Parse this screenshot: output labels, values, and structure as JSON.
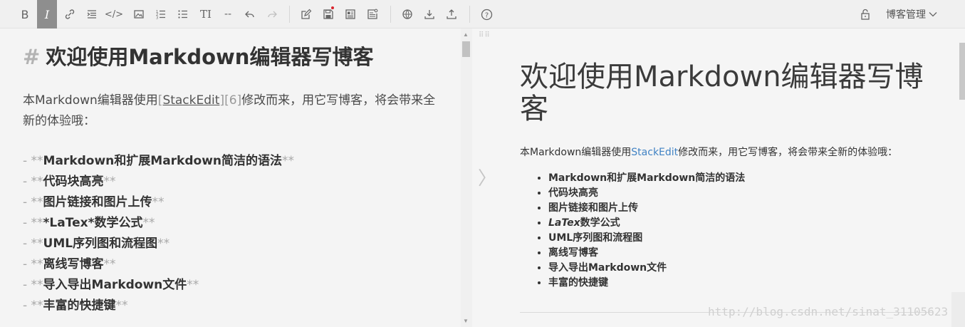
{
  "toolbar": {
    "icons": {
      "bold": "B",
      "italic": "I",
      "link": "link-icon",
      "quote": "quote-icon",
      "code": "</>",
      "image": "image-icon",
      "ordered_list": "ordered-list-icon",
      "unordered_list": "unordered-list-icon",
      "heading": "TI",
      "hr": "--",
      "undo": "undo-icon",
      "redo": "redo-icon",
      "new": "new-doc-icon",
      "save": "save-icon",
      "publish": "publish-icon",
      "settings": "settings-doc-icon",
      "globe": "globe-icon",
      "import": "import-icon",
      "export": "export-icon",
      "help": "?"
    },
    "blog_menu_label": "博客管理"
  },
  "editor": {
    "title_hash": "#",
    "title": "欢迎使用Markdown编辑器写博客",
    "para_before": "本Markdown编辑器使用",
    "para_bracket_open": "[",
    "para_link": "StackEdit",
    "para_bracket_close": "]",
    "para_ref": "[6]",
    "para_after": "修改而来，用它写博客，将会带来全新的体验哦：",
    "list": [
      {
        "prefix": "- **",
        "text": "Markdown和扩展Markdown简洁的语法",
        "suffix": "**"
      },
      {
        "prefix": "- **",
        "text": "代码块高亮",
        "suffix": "**"
      },
      {
        "prefix": "- **",
        "text": "图片链接和图片上传",
        "suffix": "**"
      },
      {
        "prefix": "- **",
        "text": "*LaTex*数学公式",
        "suffix": "**"
      },
      {
        "prefix": "- **",
        "text": "UML序列图和流程图",
        "suffix": "**"
      },
      {
        "prefix": "- **",
        "text": "离线写博客",
        "suffix": "**"
      },
      {
        "prefix": "- **",
        "text": "导入导出Markdown文件",
        "suffix": "**"
      },
      {
        "prefix": "- **",
        "text": "丰富的快捷键",
        "suffix": "**"
      }
    ]
  },
  "preview": {
    "title": "欢迎使用Markdown编辑器写博客",
    "para_before": "本Markdown编辑器使用",
    "para_link": "StackEdit",
    "para_after": "修改而来，用它写博客，将会带来全新的体验哦：",
    "list": [
      "Markdown和扩展Markdown简洁的语法",
      "代码块高亮",
      "图片链接和图片上传",
      "数学公式",
      "UML序列图和流程图",
      "离线写博客",
      "导入导出Markdown文件",
      "丰富的快捷键"
    ],
    "latex_label": "LaTex",
    "watermark": "http://blog.csdn.net/sinat_31105623"
  }
}
